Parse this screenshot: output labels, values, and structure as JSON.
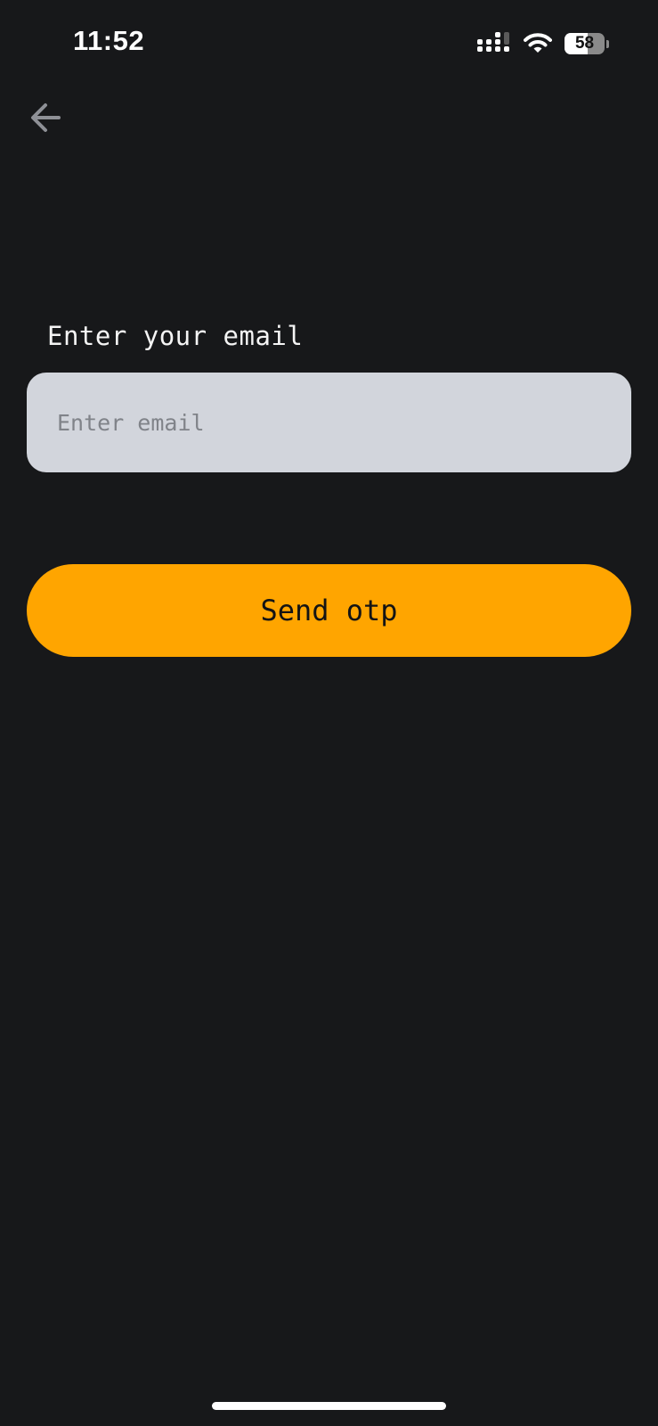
{
  "status_bar": {
    "time": "11:52",
    "battery_level": "58",
    "battery_fraction": 0.58,
    "signal_icon": "cellular-signal-icon",
    "wifi_icon": "wifi-icon"
  },
  "nav": {
    "back_icon": "arrow-left-icon"
  },
  "form": {
    "label": "Enter your email",
    "email_value": "",
    "email_placeholder": "Enter email",
    "submit_label": "Send otp"
  },
  "colors": {
    "background": "#17181a",
    "input_background": "#d2d5dc",
    "accent": "#ffa500",
    "back_icon": "#8e9096"
  }
}
